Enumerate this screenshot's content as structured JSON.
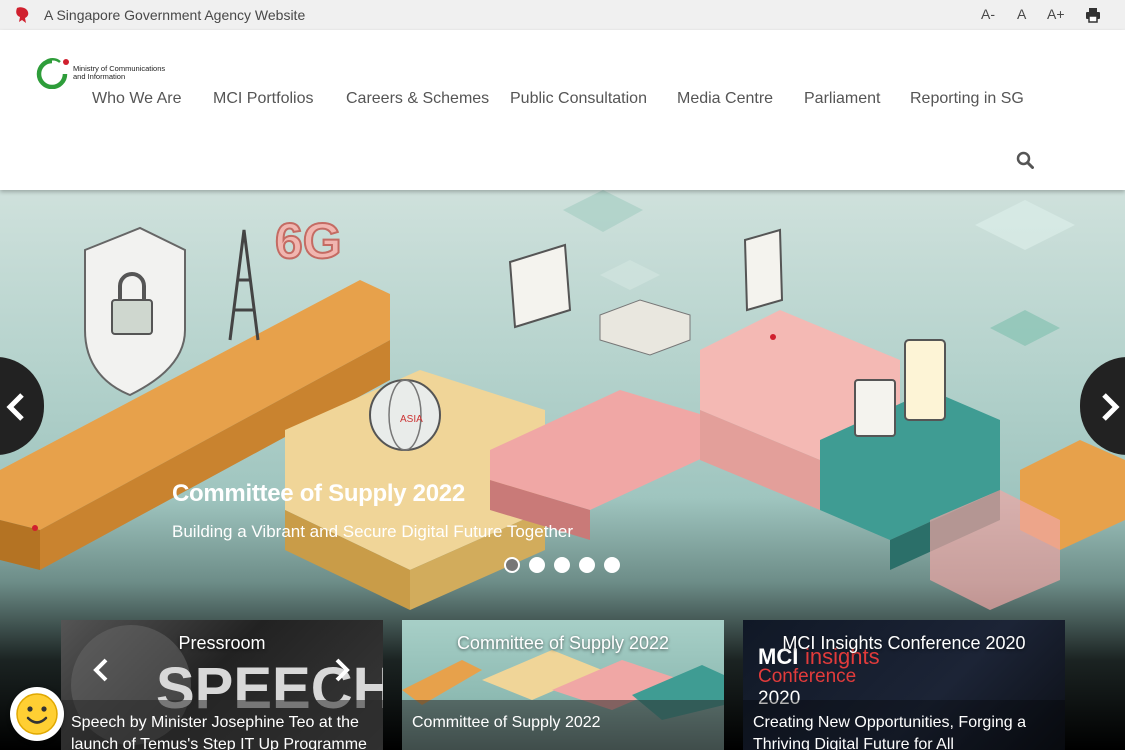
{
  "gov_bar": {
    "text": "A Singapore Government Agency Website",
    "font_small": "A-",
    "font_normal": "A",
    "font_large": "A+"
  },
  "logo": {
    "text_line1": "Ministry of Communications",
    "text_line2": "and Information"
  },
  "nav": [
    "Who We Are",
    "MCI Portfolios",
    "Careers & Schemes",
    "Public Consultation",
    "Media Centre",
    "Parliament",
    "Reporting in SG"
  ],
  "hero": {
    "title": "Committee of Supply 2022",
    "subtitle": "Building a Vibrant and Secure Digital Future Together",
    "slide_count": 5,
    "active_slide": 1,
    "art_text_6g": "6G",
    "art_text_asia": "ASIA"
  },
  "cards": [
    {
      "heading": "Pressroom",
      "caption_line1": "Speech by Minister Josephine Teo at the",
      "caption_line2": "launch of Temus's Step IT Up Programme",
      "image_text": "SPEECH"
    },
    {
      "heading": "Committee of Supply 2022",
      "caption_line1": "Committee of Supply 2022"
    },
    {
      "heading": "MCI Insights Conference 2020",
      "caption_line1": "Creating New Opportunities, Forging a",
      "caption_line2": "Thriving Digital Future for All",
      "image_text_mci": "MCI",
      "image_text_insights": "insights",
      "image_text_conf": "Conference",
      "image_text_year": "2020"
    }
  ],
  "colors": {
    "accent_red": "#d0202e",
    "logo_green": "#2e9d3a",
    "nav_text": "#555555"
  }
}
